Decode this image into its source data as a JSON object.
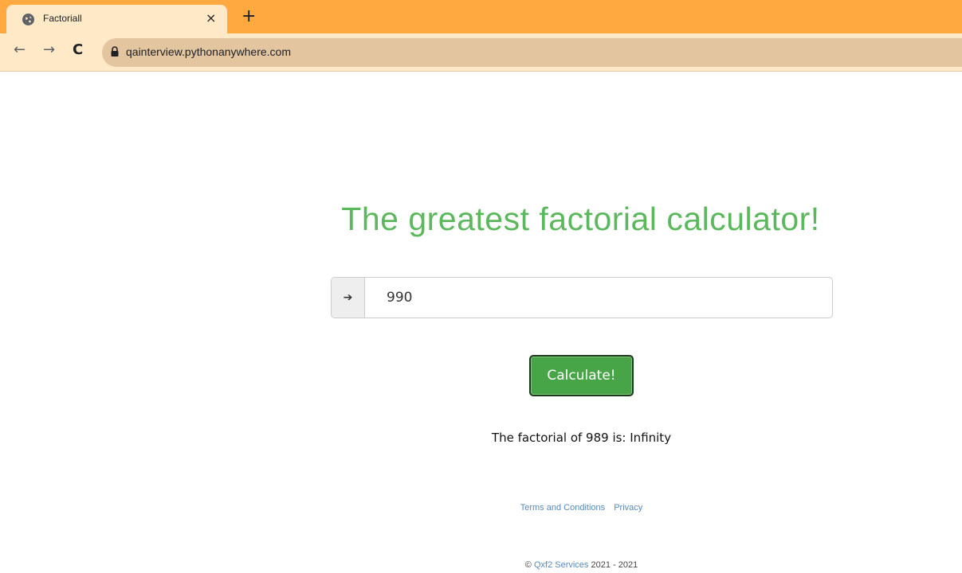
{
  "browser": {
    "tab_title": "Factoriall",
    "tab_close": "×",
    "new_tab": "+",
    "favicon": "globe-icon",
    "nav": {
      "back": "←",
      "forward": "→",
      "reload": "C"
    },
    "url": "qainterview.pythonanywhere.com",
    "theme_color": "#ffa940"
  },
  "page": {
    "title": "The greatest factorial calculator!",
    "title_color": "#5cb85c",
    "input_addon": "➔",
    "input_value": "990",
    "button_label": "Calculate!",
    "button_color": "#47a447",
    "result": "The factorial of 989 is: Infinity",
    "footer": {
      "terms": "Terms and Conditions",
      "privacy": "Privacy",
      "copyright_symbol": "©",
      "company": "Qxf2 Services",
      "years": "2021 - 2021"
    }
  }
}
